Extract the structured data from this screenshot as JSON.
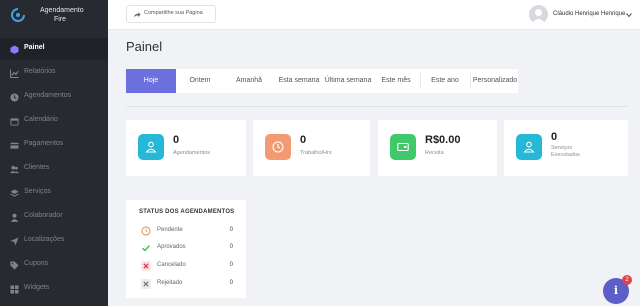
{
  "brand": {
    "line1": "Agendamento",
    "line2": "Fire"
  },
  "sidebar": {
    "items": [
      {
        "label": "Painel",
        "icon": "cube-icon"
      },
      {
        "label": "Relatórios",
        "icon": "chart-icon"
      },
      {
        "label": "Agendamentos",
        "icon": "clock-icon"
      },
      {
        "label": "Calendário",
        "icon": "calendar-icon"
      },
      {
        "label": "Pagamentos",
        "icon": "card-icon"
      },
      {
        "label": "Clientes",
        "icon": "users-icon"
      },
      {
        "label": "Serviços",
        "icon": "layers-icon"
      },
      {
        "label": "Colaborador",
        "icon": "user-icon"
      },
      {
        "label": "Localizações",
        "icon": "send-icon"
      },
      {
        "label": "Cupons",
        "icon": "tag-icon"
      },
      {
        "label": "Widgets",
        "icon": "widget-icon"
      }
    ]
  },
  "topbar": {
    "share_label": "Compartilhe sua Página",
    "user_name": "Cláudio Henrique Henrique"
  },
  "page": {
    "title": "Painel"
  },
  "filters": [
    "Hoje",
    "Ontem",
    "Amanhã",
    "Esta semana",
    "Última semana",
    "Este mês",
    "Este ano",
    "Personalizado"
  ],
  "stats": [
    {
      "value": "0",
      "label": "Agendamentos",
      "color": "#25b9d7"
    },
    {
      "value": "0",
      "label": "Trabalho/Hrs",
      "color": "#f39a72"
    },
    {
      "value": "R$0.00",
      "label": "Receita",
      "color": "#40c96b"
    },
    {
      "value": "0",
      "label": "Serviços\nExecutados",
      "color": "#25b9d7"
    }
  ],
  "status": {
    "title": "STATUS DOS AGENDAMENTOS",
    "rows": [
      {
        "label": "Pendente",
        "value": "0",
        "color": "#f39a72"
      },
      {
        "label": "Aprovados",
        "value": "0",
        "color": "#40c96b"
      },
      {
        "label": "Cancelado",
        "value": "0",
        "color": "#e0424f"
      },
      {
        "label": "Rejeitado",
        "value": "0",
        "color": "#888888"
      }
    ]
  },
  "help": {
    "icon": "info-icon",
    "glyph": "i",
    "badge": "2"
  }
}
